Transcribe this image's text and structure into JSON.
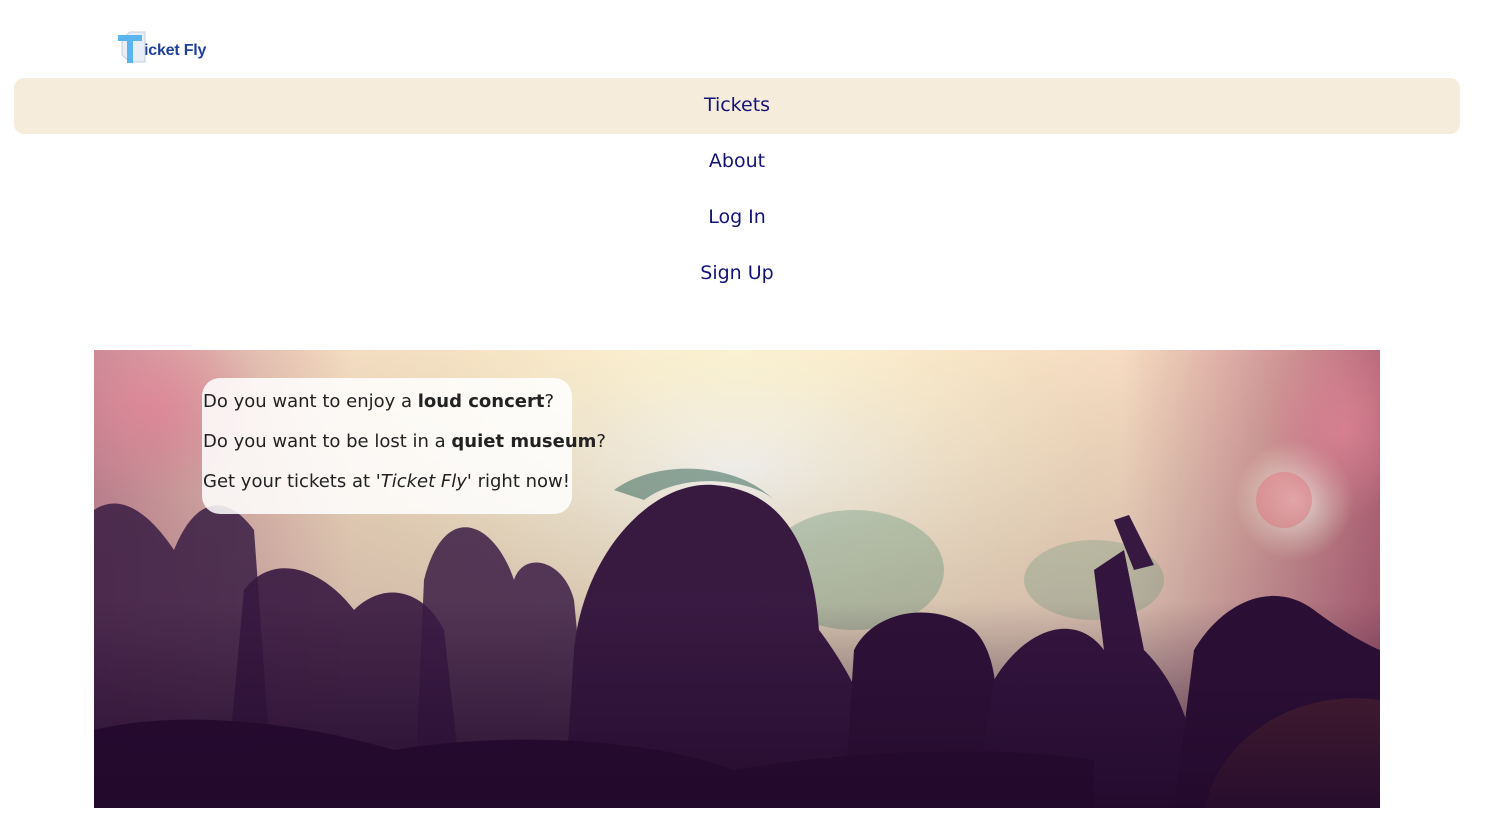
{
  "brand": {
    "name": "Ticket Fly",
    "logo_letter": "T",
    "logo_text": "icket Fly",
    "colors": {
      "logo_text": "#1f3f9f",
      "logo_mark": "#5ab4f0"
    }
  },
  "nav": {
    "items": [
      {
        "label": "Tickets",
        "active": true
      },
      {
        "label": "About",
        "active": false
      },
      {
        "label": "Log In",
        "active": false
      },
      {
        "label": "Sign Up",
        "active": false
      }
    ],
    "colors": {
      "link": "#13137a",
      "active_background": "#f6ecdc"
    }
  },
  "hero": {
    "image": "concert-crowd-photo",
    "promo": {
      "line1": {
        "before": "Do you want to enjoy a ",
        "bold": "loud concert",
        "after": "?"
      },
      "line2": {
        "before": "Do you want to be lost in a ",
        "bold": "quiet museum",
        "after": "?"
      },
      "line3": {
        "before": "Get your tickets at '",
        "italic": "Ticket Fly",
        "after": "' right now!"
      }
    }
  }
}
